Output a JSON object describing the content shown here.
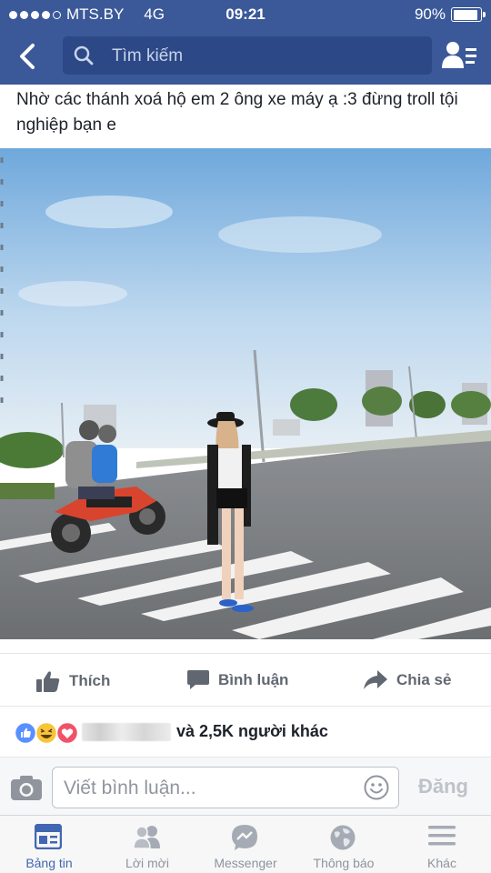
{
  "status_bar": {
    "carrier": "MTS.BY",
    "network": "4G",
    "time": "09:21",
    "battery_pct": "90%",
    "battery_level": 0.9,
    "signal_bars_filled": 4,
    "signal_bars_total": 5
  },
  "nav": {
    "back_icon": "chevron-left-icon",
    "search_placeholder": "Tìm kiếm",
    "friends_icon": "friend-requests-icon"
  },
  "post": {
    "caption": "Nhờ các thánh xoá hộ em 2 ông xe máy ạ :3 đừng troll tội nghiệp bạn e"
  },
  "actions": {
    "like_label": "Thích",
    "comment_label": "Bình luận",
    "share_label": "Chia sẻ"
  },
  "reactions": {
    "icons": [
      "like-reaction-icon",
      "haha-reaction-icon",
      "love-reaction-icon"
    ],
    "summary": "và 2,5K người khác"
  },
  "comment": {
    "placeholder": "Viết bình luận...",
    "post_label": "Đăng"
  },
  "tabs": [
    {
      "label": "Bảng tin",
      "icon": "news-feed-icon",
      "active": true
    },
    {
      "label": "Lời mời",
      "icon": "friend-requests-icon",
      "active": false
    },
    {
      "label": "Messenger",
      "icon": "messenger-icon",
      "active": false
    },
    {
      "label": "Thông báo",
      "icon": "globe-notifications-icon",
      "active": false
    },
    {
      "label": "Khác",
      "icon": "menu-icon",
      "active": false
    }
  ],
  "colors": {
    "brand_blue": "#3b5998",
    "active_tab": "#4267b2",
    "muted_text": "#616770"
  }
}
